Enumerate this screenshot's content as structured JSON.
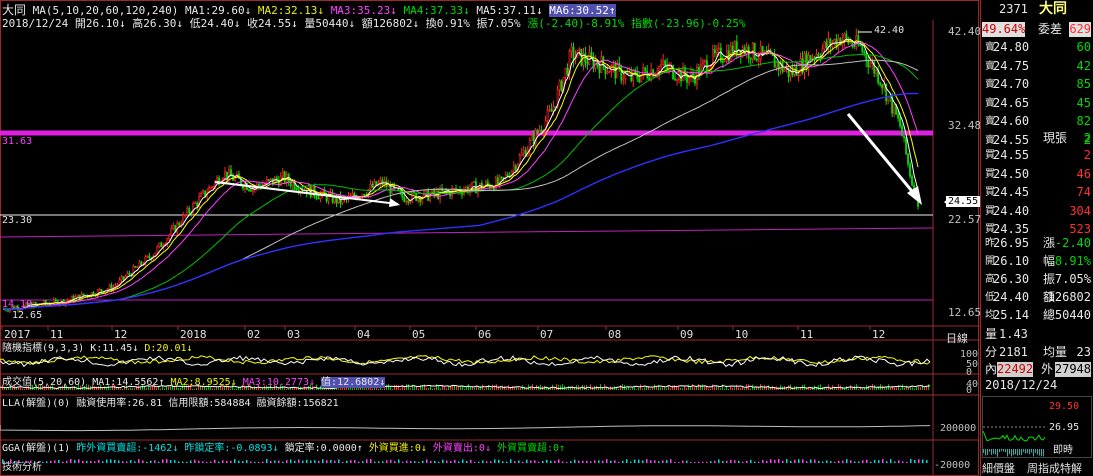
{
  "header": {
    "name": "大同",
    "ma_def": "MA(5,10,20,60,120,240)",
    "ma1": "MA1:29.60↓",
    "ma2": "MA2:32.13↓",
    "ma3": "MA3:35.23↓",
    "ma4": "MA4:37.33↓",
    "ma5": "MA5:37.11↓",
    "ma6": "MA6:30.52↑",
    "date": "2018/12/24",
    "open": "開26.10↓",
    "high": "高26.30↓",
    "low": "低24.40↓",
    "close": "收24.55↓",
    "vol": "量50440↓",
    "amt": "額126802↓",
    "turnover": "換0.91%",
    "amplitude": "振7.05%",
    "change": "漲(-2.40)-8.91%",
    "index": "指數(-23.96)-0.25%"
  },
  "price_axis": {
    "labels": [
      "42.40",
      "32.48",
      "22.57",
      "12.65"
    ],
    "left_labels": [
      "31.63",
      "23.30",
      "14.19",
      "12.65"
    ],
    "peak_label": "42.40",
    "current_tag": "24.55"
  },
  "time_axis": [
    "2017",
    "11",
    "12",
    "2018",
    "02",
    "03",
    "04",
    "05",
    "06",
    "07",
    "08",
    "09",
    "10",
    "11",
    "12"
  ],
  "time_unit": "日線",
  "panels": {
    "kd": {
      "title": "隨機指標(9,3,3)",
      "k": "K:11.45↓",
      "d": "D:20.01↓",
      "scale": [
        "100",
        "50",
        "0"
      ]
    },
    "vol": {
      "title": "成交值(5,20,60)",
      "ma1": "MA1:14.5562↑",
      "ma2": "MA2:8.9525↓",
      "ma3": "MA3:10.2773↓",
      "val": "值:12.6802↓",
      "scale": [
        "40",
        "0"
      ]
    },
    "lla": {
      "title": "LLA(解盤)(0)",
      "usage": "融資使用率:26.81",
      "credit": "信用限額:584884",
      "balance": "融資餘額:156821",
      "scale": [
        "200000"
      ]
    },
    "gga": {
      "title": "GGA(解盤)(1)",
      "f1": "昨外資買賣超:-1462↓",
      "f2": "昨鎖定率:-0.0893↓",
      "f3": "鎖定率:0.0000↑",
      "f4": "外資買進:0↓",
      "f5": "外資賣出:0↓",
      "f6": "外資買賣超:0↑",
      "scale": [
        "-20000"
      ]
    },
    "tech": "技術分析"
  },
  "right_panel": {
    "code": "2371",
    "name": "大同",
    "pct": "49.64%",
    "weibi": "委差",
    "weibi_val": "629",
    "sell_label": "賣",
    "buy_label": "買",
    "sells": [
      {
        "p": "24.80",
        "q": "60"
      },
      {
        "p": "24.75",
        "q": "42"
      },
      {
        "p": "24.70",
        "q": "85"
      },
      {
        "p": "24.65",
        "q": "45"
      },
      {
        "p": "24.60",
        "q": "82"
      },
      {
        "p": "24.55",
        "q": "2"
      }
    ],
    "now_label": "現張",
    "now_val": "2",
    "buys": [
      {
        "p": "24.55",
        "q": "2"
      },
      {
        "p": "24.50",
        "q": "46"
      },
      {
        "p": "24.45",
        "q": "74"
      },
      {
        "p": "24.40",
        "q": "304"
      },
      {
        "p": "24.35",
        "q": "523"
      }
    ],
    "stats": [
      {
        "l": "昨",
        "lv": "26.95",
        "r": "漲",
        "rv": "-2.40"
      },
      {
        "l": "開",
        "lv": "26.10",
        "r": "幅",
        "rv": "-8.91%"
      },
      {
        "l": "高",
        "lv": "26.30",
        "r": "振",
        "rv": "7.05%"
      },
      {
        "l": "低",
        "lv": "24.40",
        "r": "額",
        "rv": "126802"
      },
      {
        "l": "均",
        "lv": "25.14",
        "r": "總",
        "rv": "50440"
      }
    ],
    "liang": "量",
    "liang_val": "1.43",
    "fen": "分",
    "fen_val": "2181",
    "junliang": "均量",
    "junliang_val": "23",
    "nei": "內",
    "nei_val": "22492",
    "wai": "外",
    "wai_val": "27948",
    "date": "2018/12/24",
    "mini_prices": [
      "29.50",
      "26.95"
    ],
    "mini_time": "即時",
    "tab1": "細價盤",
    "tab2": "周指成特解"
  },
  "colors": {
    "pink_line": "#e020e0",
    "up": "#ff2828",
    "down": "#00e000",
    "ma5": "#ffffff",
    "ma10": "#ffff00",
    "ma20": "#ff40ff",
    "ma60": "#00c000",
    "ma120": "#c0c0c0",
    "ma240": "#3030ff"
  }
}
